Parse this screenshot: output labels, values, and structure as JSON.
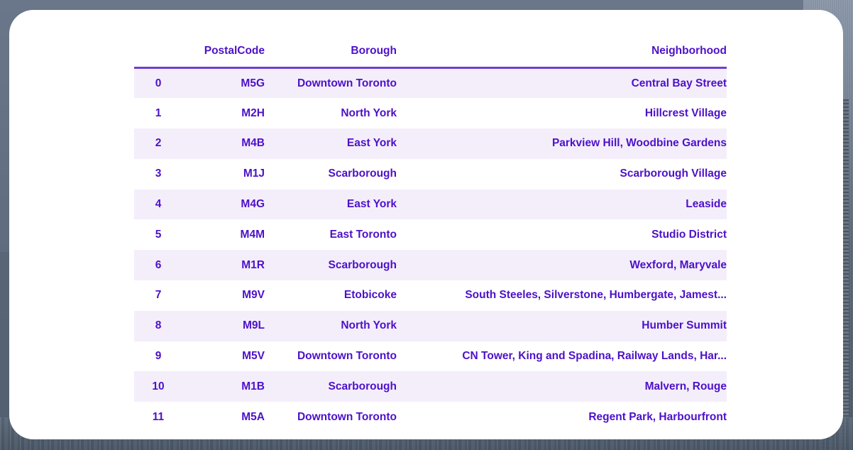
{
  "card": {
    "background_color": "#ffffff",
    "backdrop_color": "#5e6b7e"
  },
  "table": {
    "accent_color": "#4d11c9",
    "rule_color": "#6f3fd4",
    "stripe_color": "#f4eefb",
    "index_header": "",
    "columns": [
      "PostalCode",
      "Borough",
      "Neighborhood"
    ],
    "rows": [
      {
        "index": "0",
        "postal_code": "M5G",
        "borough": "Downtown Toronto",
        "neighborhood": "Central Bay Street"
      },
      {
        "index": "1",
        "postal_code": "M2H",
        "borough": "North York",
        "neighborhood": "Hillcrest Village"
      },
      {
        "index": "2",
        "postal_code": "M4B",
        "borough": "East York",
        "neighborhood": "Parkview Hill, Woodbine Gardens"
      },
      {
        "index": "3",
        "postal_code": "M1J",
        "borough": "Scarborough",
        "neighborhood": "Scarborough Village"
      },
      {
        "index": "4",
        "postal_code": "M4G",
        "borough": "East York",
        "neighborhood": "Leaside"
      },
      {
        "index": "5",
        "postal_code": "M4M",
        "borough": "East Toronto",
        "neighborhood": "Studio District"
      },
      {
        "index": "6",
        "postal_code": "M1R",
        "borough": "Scarborough",
        "neighborhood": "Wexford, Maryvale"
      },
      {
        "index": "7",
        "postal_code": "M9V",
        "borough": "Etobicoke",
        "neighborhood": "South Steeles, Silverstone, Humbergate, Jamest..."
      },
      {
        "index": "8",
        "postal_code": "M9L",
        "borough": "North York",
        "neighborhood": "Humber Summit"
      },
      {
        "index": "9",
        "postal_code": "M5V",
        "borough": "Downtown Toronto",
        "neighborhood": "CN Tower, King and Spadina, Railway Lands, Har..."
      },
      {
        "index": "10",
        "postal_code": "M1B",
        "borough": "Scarborough",
        "neighborhood": "Malvern, Rouge"
      },
      {
        "index": "11",
        "postal_code": "M5A",
        "borough": "Downtown Toronto",
        "neighborhood": "Regent Park, Harbourfront"
      }
    ]
  }
}
